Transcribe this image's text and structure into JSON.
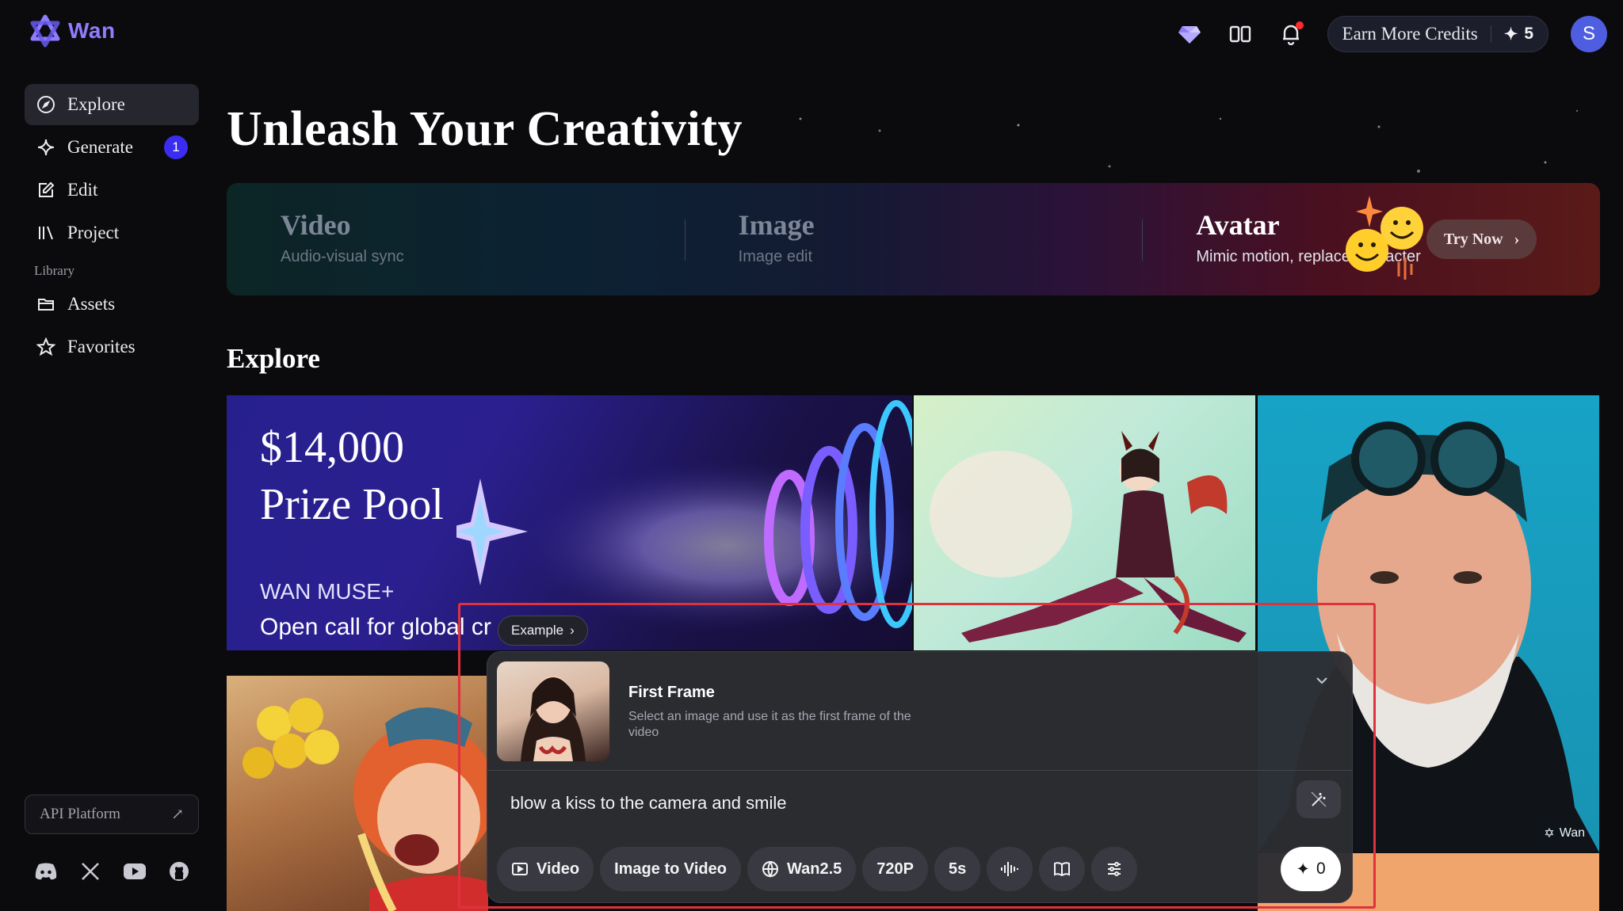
{
  "app": {
    "name": "Wan"
  },
  "header": {
    "earn_credits_label": "Earn More Credits",
    "credits_count": "5",
    "avatar_initial": "S",
    "icons": [
      "wan-gem-icon",
      "book-icon",
      "bell-icon"
    ]
  },
  "sidebar": {
    "items": [
      {
        "label": "Explore",
        "icon": "compass-icon",
        "active": true
      },
      {
        "label": "Generate",
        "icon": "sparkle-icon",
        "badge": "1"
      },
      {
        "label": "Edit",
        "icon": "edit-icon"
      },
      {
        "label": "Project",
        "icon": "library-icon"
      }
    ],
    "section_label": "Library",
    "library_items": [
      {
        "label": "Assets",
        "icon": "folder-icon"
      },
      {
        "label": "Favorites",
        "icon": "star-icon"
      }
    ],
    "api_label": "API Platform",
    "socials": [
      "discord-icon",
      "x-icon",
      "youtube-icon",
      "github-icon"
    ]
  },
  "main": {
    "title": "Unleash Your Creativity",
    "features": [
      {
        "title": "Video",
        "subtitle": "Audio-visual sync"
      },
      {
        "title": "Image",
        "subtitle": "Image edit"
      },
      {
        "title": "Avatar",
        "subtitle": "Mimic motion, replace character"
      }
    ],
    "try_now_label": "Try Now",
    "explore_heading": "Explore",
    "promo": {
      "amount": "$14,000",
      "pool": "Prize Pool",
      "event": "WAN MUSE+",
      "call": "Open call for global cr"
    },
    "watermark": "Wan"
  },
  "prompt_panel": {
    "example_label": "Example",
    "first_frame_title": "First Frame",
    "first_frame_desc": "Select an image and use it as the first frame of the video",
    "prompt": "blow a kiss to the camera and smile",
    "toolbar": {
      "mode": "Video",
      "task": "Image to Video",
      "model": "Wan2.5",
      "resolution": "720P",
      "duration": "5s"
    },
    "cost": "0"
  },
  "colors": {
    "accent": "#3a2cf0",
    "brand": "#8f7dff",
    "highlight": "#e0313f"
  }
}
